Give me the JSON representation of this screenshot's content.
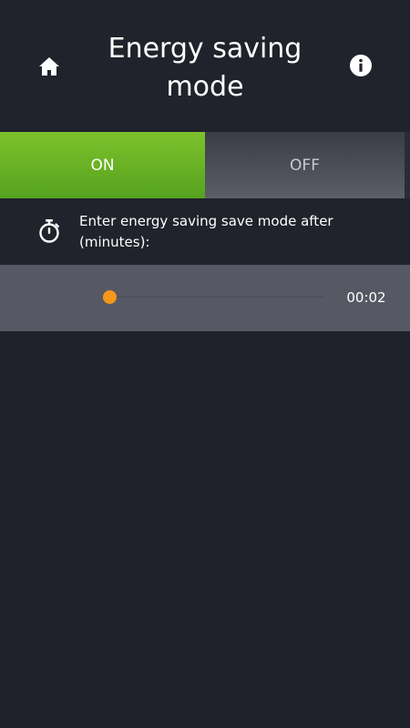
{
  "header": {
    "title": "Energy saving mode",
    "home_icon": "home-icon",
    "info_icon": "info-icon"
  },
  "toggle": {
    "on_label": "ON",
    "off_label": "OFF",
    "selected": "ON",
    "on_color": "#6ab527"
  },
  "setting": {
    "icon": "stopwatch-icon",
    "label": "Enter energy saving save mode after (minutes):"
  },
  "slider": {
    "value": "00:02",
    "fraction": 0,
    "thumb_color": "#f7961c"
  }
}
